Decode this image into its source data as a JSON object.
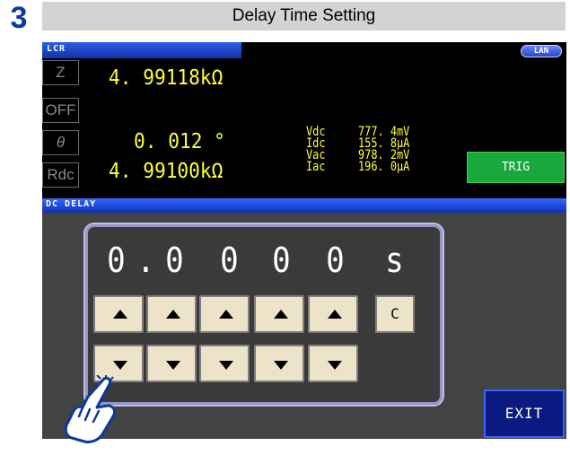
{
  "step": {
    "number": "3"
  },
  "title": "Delay Time Setting",
  "screen": {
    "mode_tab": "LCR",
    "lan_badge": "LAN",
    "params": [
      "Z",
      "OFF",
      "θ",
      "Rdc"
    ],
    "measurements": {
      "z_value": "4. 99118kΩ",
      "theta_value": "0. 012 °",
      "rdc_value": "4. 99100kΩ"
    },
    "monitors": [
      {
        "label": "Vdc",
        "value": "777. 4mV"
      },
      {
        "label": "Idc",
        "value": "155. 8µA"
      },
      {
        "label": "Vac",
        "value": "978. 2mV"
      },
      {
        "label": "Iac",
        "value": "196. 0µA"
      }
    ],
    "trig_label": "TRIG",
    "section_label": "DC DELAY",
    "delay_digits": [
      "0",
      ".",
      "0",
      "0",
      "0",
      "0",
      "s"
    ],
    "clear_label": "C",
    "exit_label": "EXIT"
  },
  "colors": {
    "accent_blue": "#0b3a9c",
    "measure_yellow": "#ffff3a",
    "trig_green": "#19a83c",
    "key_face": "#ece3c9"
  },
  "icons": {
    "up_arrow": "triangle-up",
    "down_arrow": "triangle-down",
    "hand_pointer": "hand-pointer-icon"
  }
}
